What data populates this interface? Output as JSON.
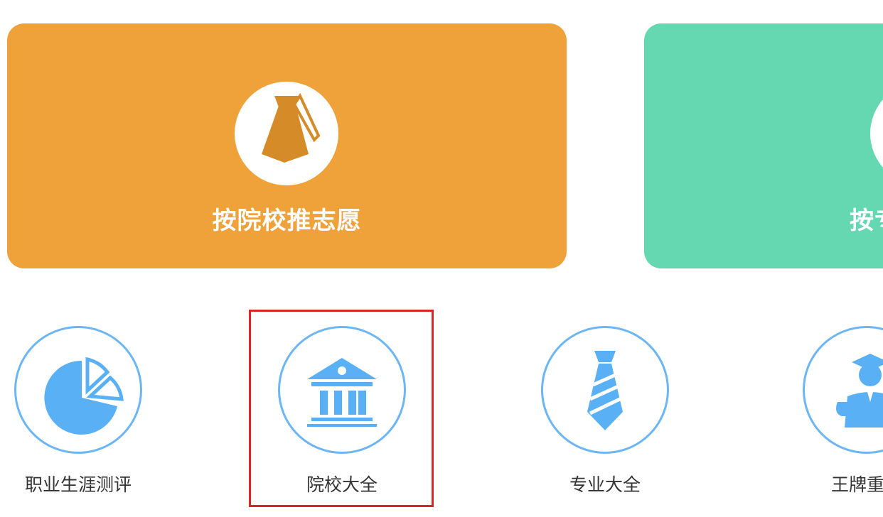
{
  "cards": [
    {
      "label": "按院校推志愿",
      "color": "#efa13a",
      "icon": "tie-icon"
    },
    {
      "label": "按专",
      "color": "#65d8b1",
      "icon": "circle-icon"
    }
  ],
  "shortcuts": [
    {
      "label": "职业生涯测评",
      "icon": "pie-chart-icon"
    },
    {
      "label": "院校大全",
      "icon": "school-building-icon"
    },
    {
      "label": "专业大全",
      "icon": "striped-tie-icon"
    },
    {
      "label": "王牌重点",
      "icon": "graduate-icon"
    }
  ],
  "colors": {
    "accent_blue": "#6cb6f5",
    "highlight_red": "#d9262a"
  }
}
